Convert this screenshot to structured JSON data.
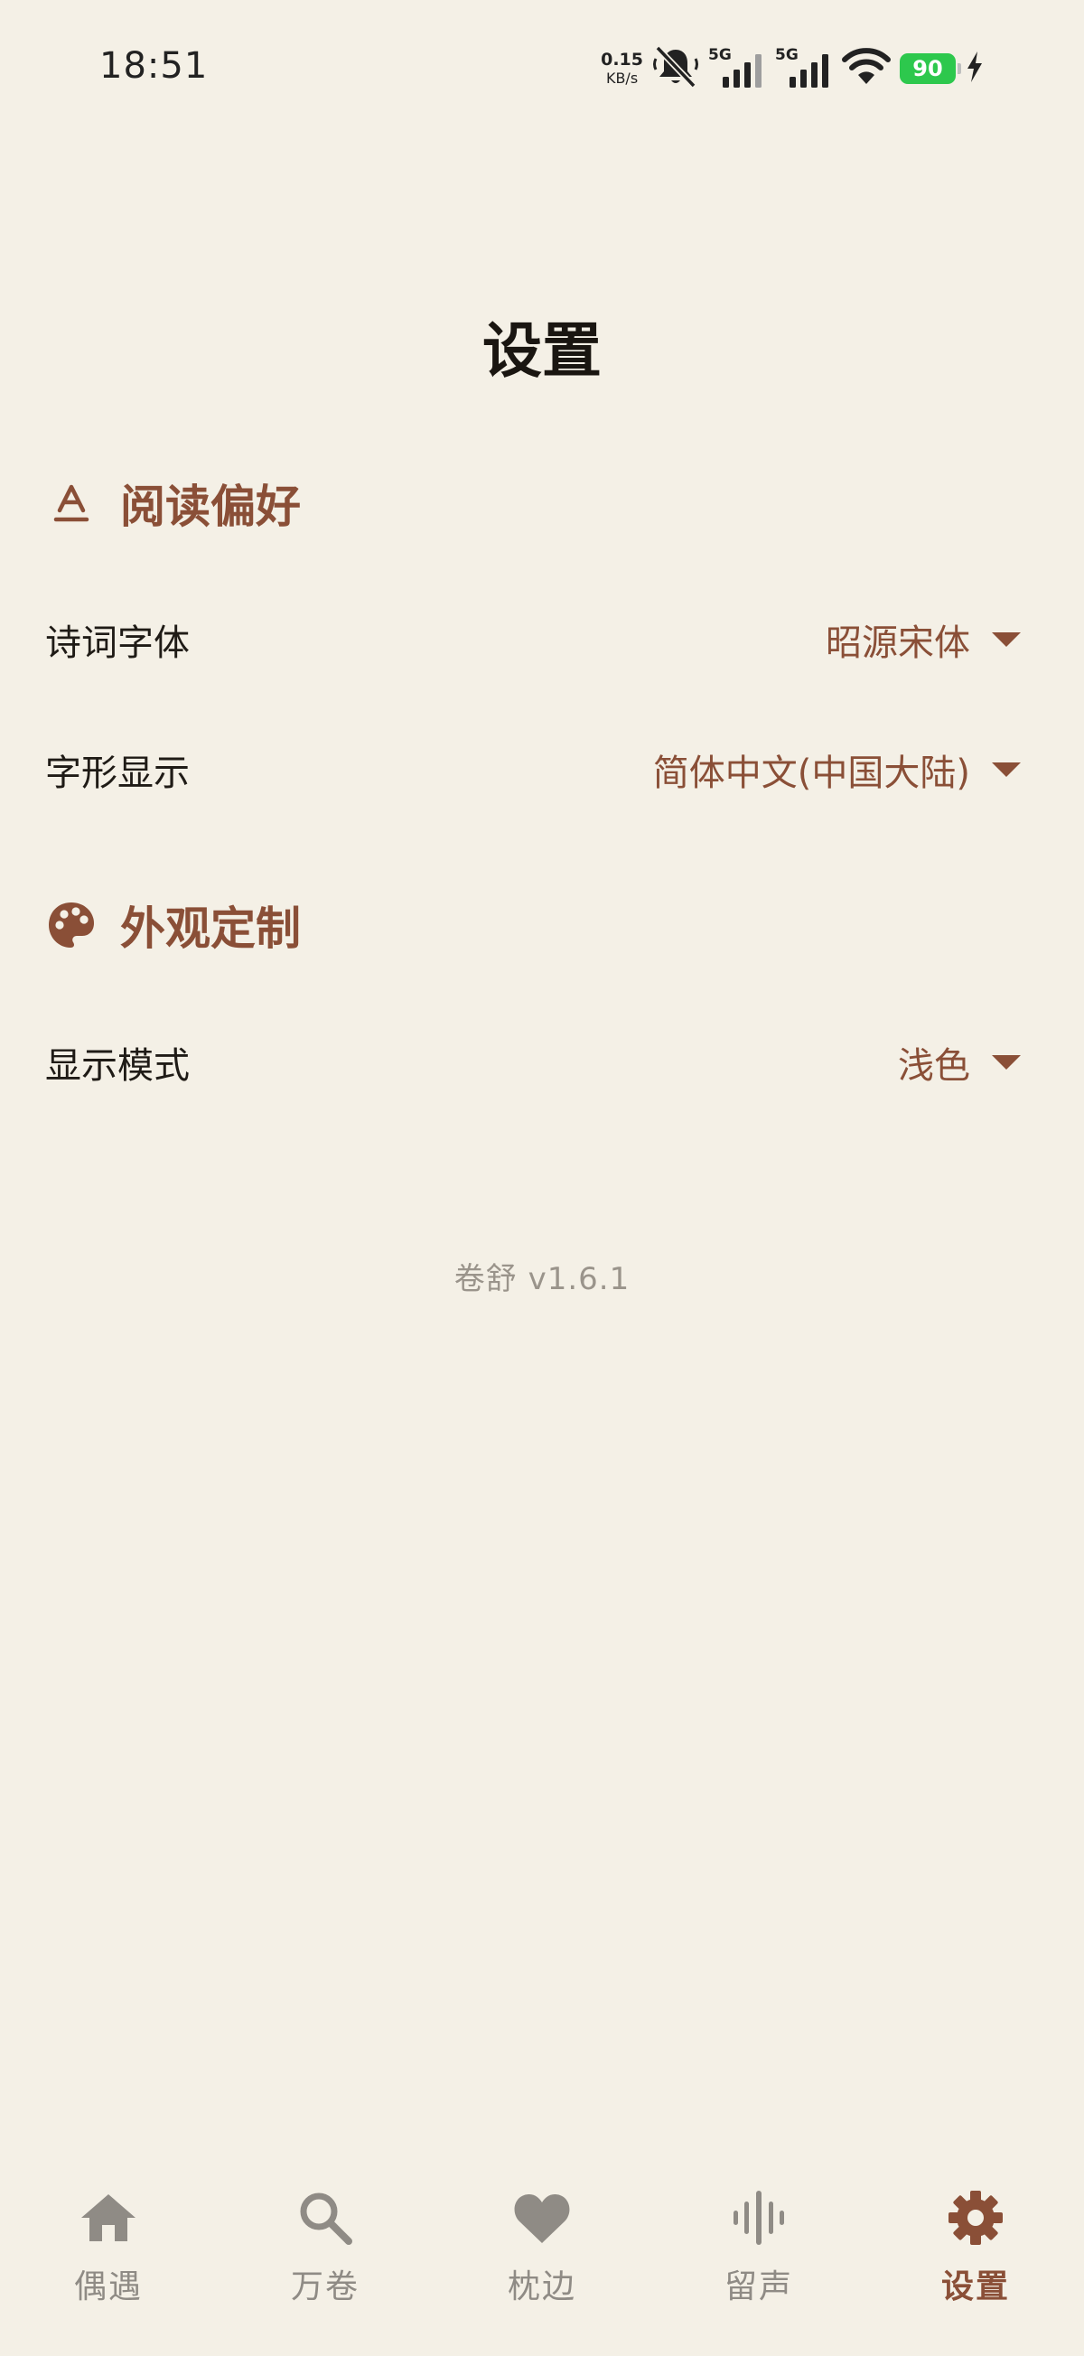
{
  "status_bar": {
    "time": "18:51",
    "net_speed_value": "0.15",
    "net_speed_unit": "KB/s",
    "sim1_tag": "5G",
    "sim2_tag": "5G",
    "battery_level": "90"
  },
  "page": {
    "title": "设置"
  },
  "sections": {
    "reading": {
      "title": "阅读偏好",
      "icon": "text-format-icon",
      "rows": {
        "font": {
          "name": "诗词字体",
          "value": "昭源宋体"
        },
        "script": {
          "name": "字形显示",
          "value": "简体中文(中国大陆)"
        }
      }
    },
    "appearance": {
      "title": "外观定制",
      "icon": "palette-icon",
      "rows": {
        "mode": {
          "name": "显示模式",
          "value": "浅色"
        }
      }
    }
  },
  "version": "卷舒 v1.6.1",
  "bottom_nav": {
    "items": [
      {
        "label": "偶遇",
        "icon": "home-icon"
      },
      {
        "label": "万卷",
        "icon": "search-icon"
      },
      {
        "label": "枕边",
        "icon": "heart-icon"
      },
      {
        "label": "留声",
        "icon": "audio-wave-icon"
      },
      {
        "label": "设置",
        "icon": "gear-icon"
      }
    ],
    "active_index": 4
  },
  "colors": {
    "background": "#f4f0e6",
    "accent": "#8a4f37",
    "inactive": "#8f8b85",
    "battery": "#2dc84d"
  }
}
